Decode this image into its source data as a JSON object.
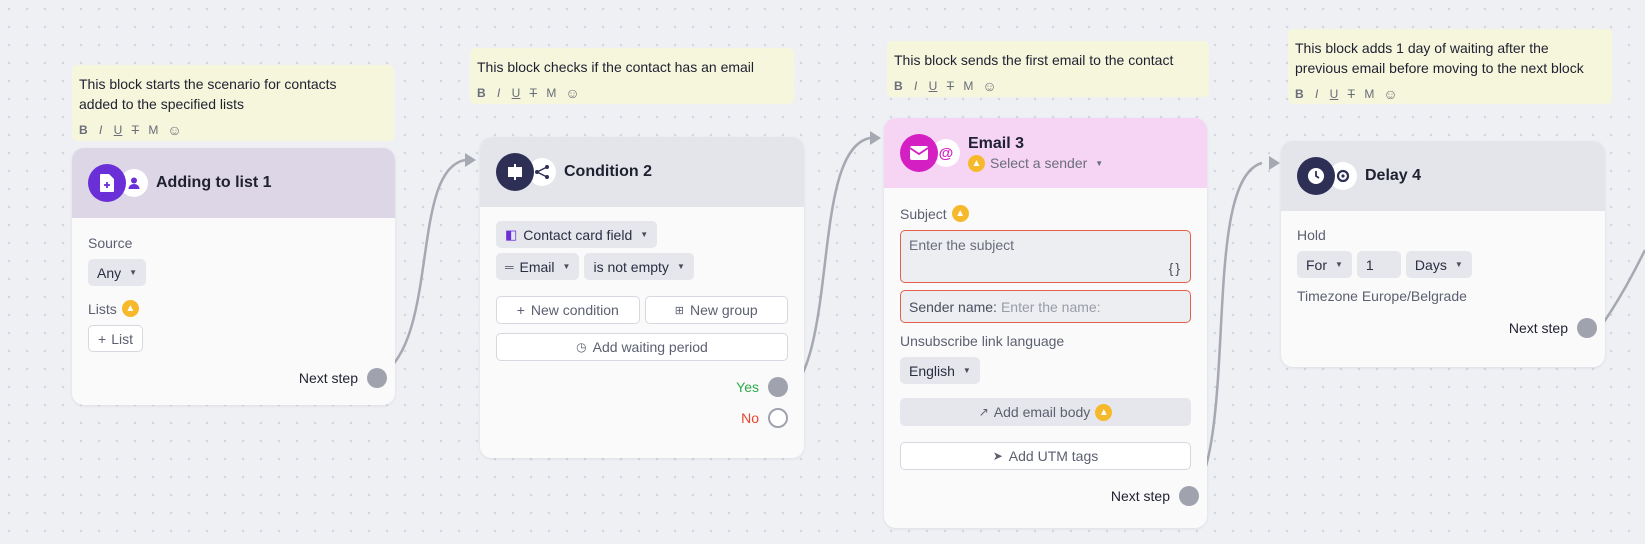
{
  "toolbar": {
    "bold": "B",
    "italic": "I",
    "underline": "U",
    "strike": "T",
    "mono": "M",
    "emoji": "☺"
  },
  "notes": [
    {
      "text_line1": "This block starts the scenario for contacts",
      "text_line2": "added to the specified lists"
    },
    {
      "text_line1": "This block checks if the contact has an email"
    },
    {
      "text_line1": "This block sends the first email to the contact"
    },
    {
      "text_line1": "This block adds 1 day of waiting after the",
      "text_line2": "previous email before moving to the next block"
    }
  ],
  "block1": {
    "title": "Adding to list 1",
    "source_label": "Source",
    "source_value": "Any",
    "lists_label": "Lists",
    "list_button": "List",
    "next_step": "Next step"
  },
  "block2": {
    "title": "Condition 2",
    "field_value": "Contact card field",
    "attr_value": "Email",
    "operator_value": "is not empty",
    "new_condition": "New condition",
    "new_group": "New group",
    "add_waiting": "Add waiting period",
    "yes": "Yes",
    "no": "No"
  },
  "block3": {
    "title": "Email 3",
    "sender_select": "Select a sender",
    "subject_label": "Subject",
    "subject_placeholder": "Enter the subject",
    "braces": "{}",
    "sender_name_label": "Sender name:",
    "sender_name_placeholder": "Enter the name:",
    "unsub_label": "Unsubscribe link language",
    "language": "English",
    "add_body": "Add email body",
    "add_utm": "Add UTM tags",
    "next_step": "Next step"
  },
  "block4": {
    "title": "Delay 4",
    "hold_label": "Hold",
    "hold_mode": "For",
    "hold_amount": "1",
    "hold_unit": "Days",
    "timezone": "Timezone Europe/Belgrade",
    "next_step": "Next step"
  },
  "colors": {
    "block1_header": "#ddd6e6",
    "block2_header": "#e3e5eb",
    "block3_header": "#f6d5f4",
    "block4_header": "#e3e5eb",
    "note_bg": "#f5f6dc",
    "purple": "#6a2fd6",
    "magenta": "#d41fc2",
    "navy": "#2e2f55",
    "yes": "#2eaa4a",
    "no": "#e5452b",
    "warning": "#f6b92b",
    "error_border": "#e5604a"
  }
}
